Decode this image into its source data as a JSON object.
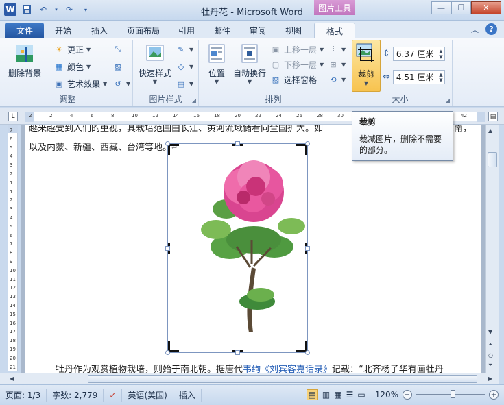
{
  "app": {
    "title": "牡丹花 - Microsoft Word",
    "logo": "W"
  },
  "contextual_tab_header": "图片工具",
  "tabs": [
    {
      "label": "文件"
    },
    {
      "label": "开始"
    },
    {
      "label": "插入"
    },
    {
      "label": "页面布局"
    },
    {
      "label": "引用"
    },
    {
      "label": "邮件"
    },
    {
      "label": "审阅"
    },
    {
      "label": "视图"
    },
    {
      "label": "格式"
    }
  ],
  "ribbon": {
    "adjust": {
      "label": "调整",
      "remove_bg": "删除背景",
      "corrections": "更正",
      "color": "颜色",
      "artistic": "艺术效果"
    },
    "picture_styles": {
      "label": "图片样式",
      "quick_styles": "快速样式"
    },
    "arrange": {
      "label": "排列",
      "position": "位置",
      "wrap_text": "自动换行",
      "bring_forward": "上移一层",
      "send_backward": "下移一层",
      "selection_pane": "选择窗格"
    },
    "size": {
      "label": "大小",
      "crop": "裁剪",
      "height": "6.37 厘米",
      "width": "4.51 厘米"
    }
  },
  "ruler": {
    "h_ticks": [
      "2",
      "2",
      "4",
      "6",
      "8",
      "10",
      "12",
      "14",
      "16",
      "18",
      "20",
      "22",
      "24",
      "26",
      "28",
      "30",
      "32",
      "34",
      "36",
      "38",
      "40",
      "42"
    ],
    "v_ticks": [
      "7",
      "6",
      "5",
      "4",
      "3",
      "2",
      "1",
      "1",
      "2",
      "3",
      "4",
      "5",
      "6",
      "7",
      "8",
      "9",
      "10",
      "11",
      "12",
      "13",
      "14",
      "15",
      "16",
      "17",
      "18",
      "19",
      "20",
      "21"
    ]
  },
  "document": {
    "line1": "越来越受到人们的重视，其栽培范围由长江、黄河流域储看向全国扩大。如",
    "line1_end": "东南，",
    "line2": "以及内蒙、新疆、西藏、台湾等地。",
    "bottom_pre": "牡丹作为观赏植物栽培，则始于南北朝。据唐代",
    "bottom_link1": "韦绚",
    "bottom_link2": "《刘宾客嘉话录》",
    "bottom_post": "记载：“北齐杨子华有画牡丹"
  },
  "tooltip": {
    "title": "裁剪",
    "body_line1": "裁减图片，删除不需要",
    "body_line2": "的部分。"
  },
  "status": {
    "page": "页面: 1/3",
    "words": "字数: 2,779",
    "language": "英语(美国)",
    "mode": "插入",
    "zoom": "120%",
    "zoom_level_percent": 120
  }
}
